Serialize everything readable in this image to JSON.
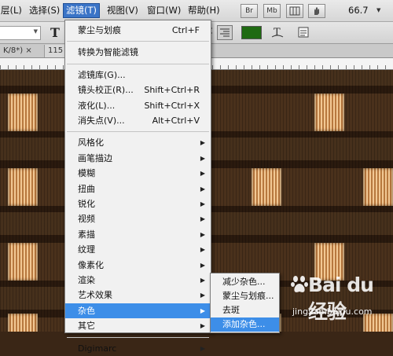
{
  "menubar": {
    "items": [
      {
        "label": "层(L)"
      },
      {
        "label": "选择(S)"
      },
      {
        "label": "滤镜(T)",
        "active": true
      },
      {
        "label": "视图(V)"
      },
      {
        "label": "窗口(W)"
      },
      {
        "label": "帮助(H)"
      }
    ],
    "bridge_button": "Br",
    "minibridge_button": "Mb",
    "zoom": "66.7",
    "colors": {
      "active": "#3a74c7",
      "highlight": "#3d8ee8"
    }
  },
  "options": {
    "type_tool_glyph": "T",
    "text_color": "#1f6a12"
  },
  "doc_tab": {
    "label": "K/8*) ×",
    "number": "115"
  },
  "filter_menu": {
    "groups": [
      [
        {
          "label": "蒙尘与划痕",
          "shortcut": "Ctrl+F"
        }
      ],
      [
        {
          "label": "转换为智能滤镜"
        }
      ],
      [
        {
          "label": "滤镜库(G)..."
        },
        {
          "label": "镜头校正(R)...",
          "shortcut": "Shift+Ctrl+R"
        },
        {
          "label": "液化(L)...",
          "shortcut": "Shift+Ctrl+X"
        },
        {
          "label": "消失点(V)...",
          "shortcut": "Alt+Ctrl+V"
        }
      ],
      [
        {
          "label": "风格化",
          "submenu": true
        },
        {
          "label": "画笔描边",
          "submenu": true
        },
        {
          "label": "模糊",
          "submenu": true
        },
        {
          "label": "扭曲",
          "submenu": true
        },
        {
          "label": "锐化",
          "submenu": true
        },
        {
          "label": "视频",
          "submenu": true
        },
        {
          "label": "素描",
          "submenu": true
        },
        {
          "label": "纹理",
          "submenu": true
        },
        {
          "label": "像素化",
          "submenu": true
        },
        {
          "label": "渲染",
          "submenu": true
        },
        {
          "label": "艺术效果",
          "submenu": true
        },
        {
          "label": "杂色",
          "submenu": true,
          "highlighted": true
        },
        {
          "label": "其它",
          "submenu": true
        }
      ],
      [
        {
          "label": "Digimarc",
          "submenu": true
        }
      ]
    ]
  },
  "noise_submenu": {
    "items": [
      {
        "label": "减少杂色..."
      },
      {
        "label": "蒙尘与划痕..."
      },
      {
        "label": "去斑"
      },
      {
        "label": "添加杂色...",
        "highlighted": true
      }
    ]
  },
  "watermark": {
    "brand": "Bai du 经验",
    "url": "jingyan.baidu.com"
  }
}
